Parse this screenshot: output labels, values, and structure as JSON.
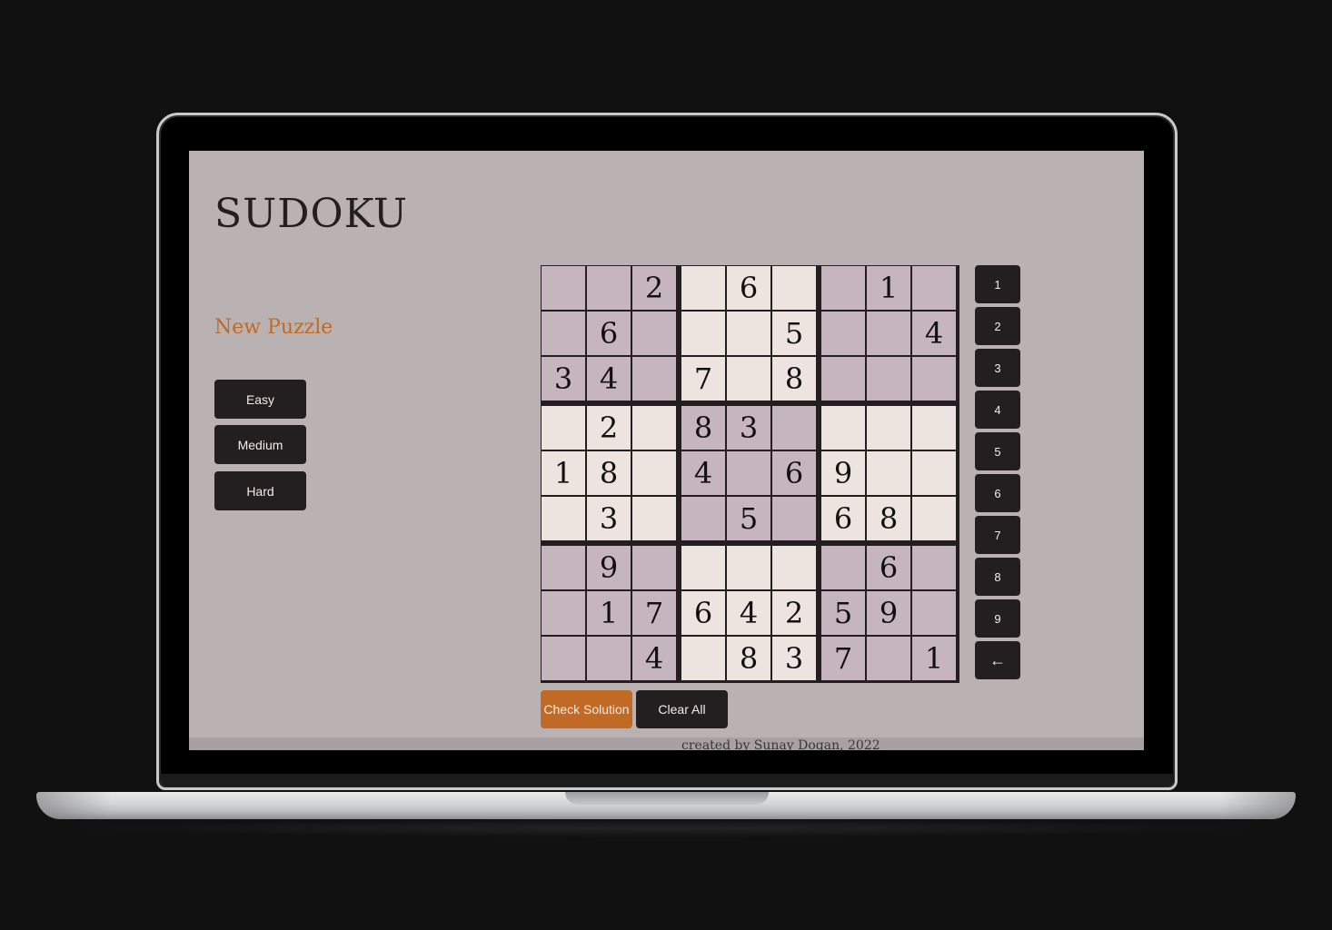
{
  "app": {
    "title": "SUDOKU",
    "new_puzzle_heading": "New Puzzle",
    "accent_color": "#c06a26",
    "button_color": "#231f20",
    "background_color": "#bab1b3"
  },
  "difficulty": {
    "buttons": [
      "Easy",
      "Medium",
      "Hard"
    ]
  },
  "board": {
    "rows": [
      [
        "",
        "",
        "2",
        "",
        "6",
        "",
        "",
        "1",
        ""
      ],
      [
        "",
        "6",
        "",
        "",
        "",
        "5",
        "",
        "",
        "4"
      ],
      [
        "3",
        "4",
        "",
        "7",
        "",
        "8",
        "",
        "",
        ""
      ],
      [
        "",
        "2",
        "",
        "8",
        "3",
        "",
        "",
        "",
        ""
      ],
      [
        "1",
        "8",
        "",
        "4",
        "",
        "6",
        "9",
        "",
        ""
      ],
      [
        "",
        "3",
        "",
        "",
        "5",
        "",
        "6",
        "8",
        ""
      ],
      [
        "",
        "9",
        "",
        "",
        "",
        "",
        "",
        "6",
        ""
      ],
      [
        "",
        "1",
        "7",
        "6",
        "4",
        "2",
        "5",
        "9",
        ""
      ],
      [
        "",
        "",
        "4",
        "",
        "8",
        "3",
        "7",
        "",
        "1"
      ]
    ],
    "dark_color": "#c6b5bf",
    "light_color": "#ede3df"
  },
  "numpad": {
    "keys": [
      "1",
      "2",
      "3",
      "4",
      "5",
      "6",
      "7",
      "8",
      "9",
      "←"
    ]
  },
  "actions": {
    "check_label": "Check Solution",
    "clear_label": "Clear All"
  },
  "footer": {
    "text": "created by Sunay Dogan, 2022"
  }
}
